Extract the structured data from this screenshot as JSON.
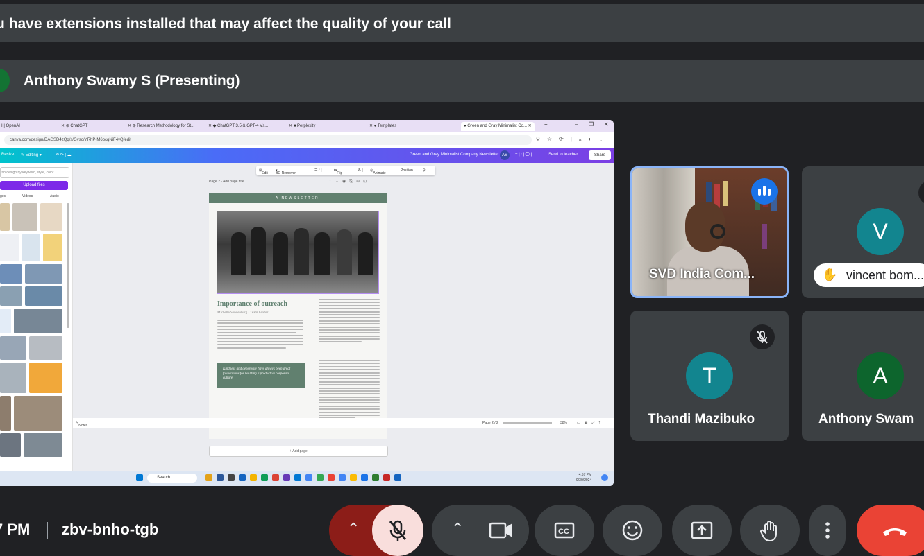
{
  "banner": {
    "text": "u have extensions installed that may affect the quality of your call"
  },
  "presenter": {
    "label": "Anthony Swamy S (Presenting)"
  },
  "screen": {
    "tabs": [
      "I | OpenAI",
      "ChatGPT",
      "Research Methodology for St...",
      "ChatGPT 3.5 & GPT-4 Vs...",
      "Perplexity",
      "Templates",
      "Green and Gray Minimalist Co..."
    ],
    "url": "canva.com/design/DAGSD4zQq/s/Gvso/YRhP-M6ocqNiF4vQ/edit",
    "toolbar": {
      "resize": "Resize",
      "editing": "Editing",
      "doc_title": "Green and Gray Minimalist Company Newsletter",
      "avatar": "AS",
      "send": "Send to teacher",
      "share": "Share"
    },
    "sidepanel": {
      "search_placeholder": "rch design by keyword, style, color...",
      "upload": "Upload files",
      "tabs": [
        "ges",
        "Videos",
        "Audio"
      ]
    },
    "context_toolbar": {
      "edit": "Edit",
      "bg_remover": "BG Remover",
      "flip": "Flip",
      "animate": "Animate",
      "position": "Position"
    },
    "page_label": "Page 2 - Add page title",
    "page_header": "A NEWSLETTER",
    "heading": "Importance of outreach",
    "byline": "Michelle Sondenburg · Team Leader",
    "quote": "Kindness and generosity have always been great foundations for building a productive corporate culture.",
    "add_page": "+ Add page",
    "footer": {
      "notes": "Notes",
      "page": "Page 2 / 2",
      "zoom": "38%"
    },
    "taskbar": {
      "search": "Search",
      "time": "4:57 PM",
      "date": "9/30/2024"
    }
  },
  "participants": [
    {
      "name": "SVD India Com...",
      "state": "speaking",
      "speaking": true
    },
    {
      "name": "vincent bom...",
      "initial": "V",
      "color": "#12858f",
      "hand_raised": true
    },
    {
      "name": "Thandi Mazibuko",
      "initial": "T",
      "color": "#12858f",
      "muted": true
    },
    {
      "name": "Anthony Swam",
      "initial": "A",
      "color": "#0d652d"
    }
  ],
  "meeting": {
    "time": "7 PM",
    "code": "zbv-bnho-tgb"
  },
  "controls": [
    "chevron-up-icon",
    "mic-off-icon",
    "chevron-up-icon",
    "camera-icon",
    "captions-icon",
    "emoji-icon",
    "present-icon",
    "raise-hand-icon",
    "more-icon",
    "end-call-icon"
  ],
  "colors": {
    "accent": "#8ab4f8",
    "end_call": "#ea4335",
    "mic_off_bg": "#f9dedc",
    "tile_bg": "#3c4043"
  }
}
